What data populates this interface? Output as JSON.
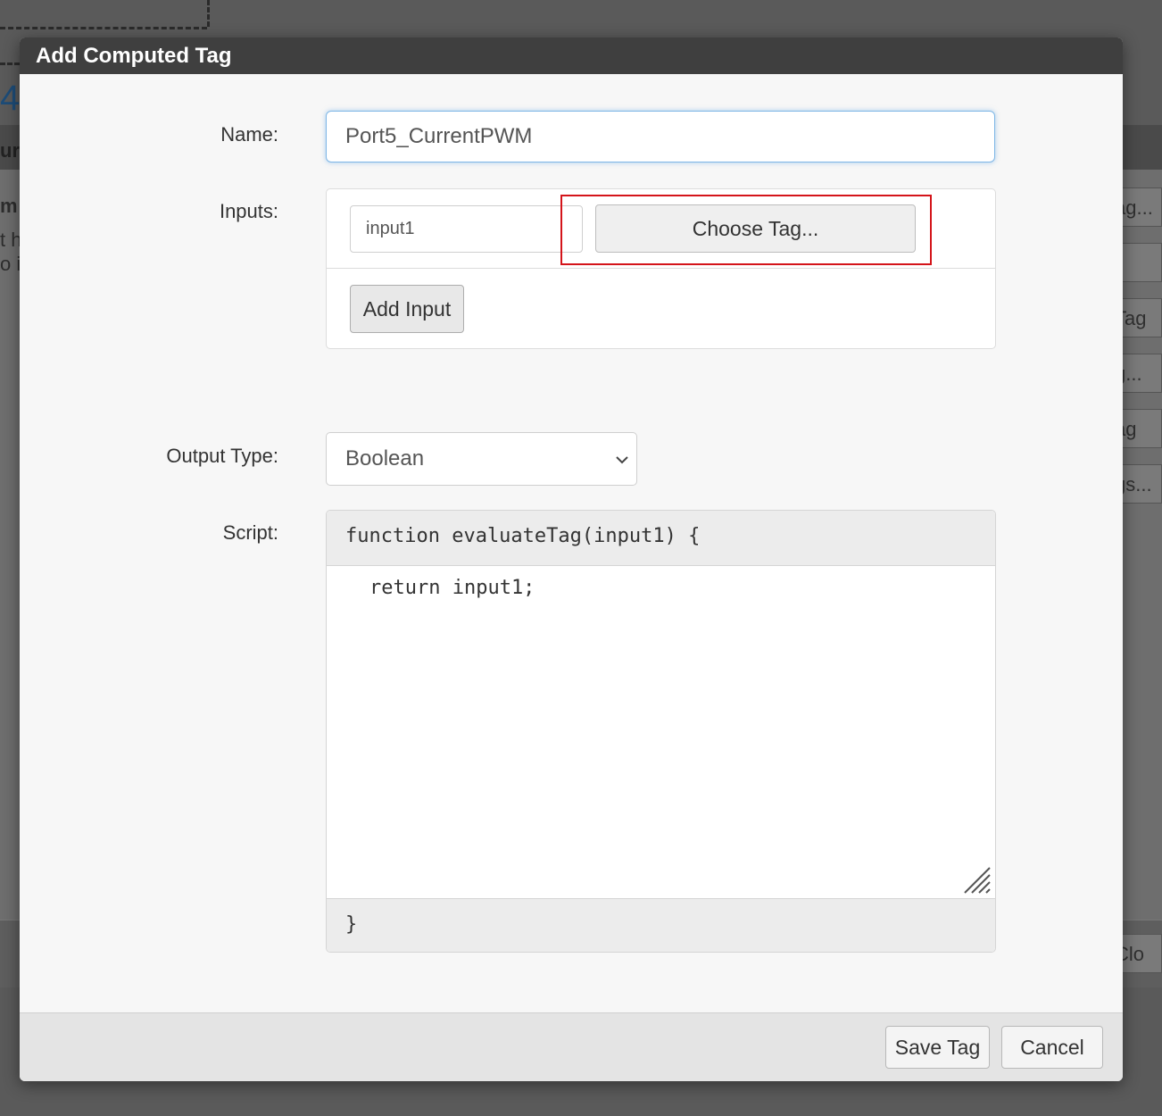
{
  "background": {
    "number_fragment": "4",
    "left_fragments": [
      "ur",
      "m",
      "t h",
      "o i"
    ],
    "right_fragments": [
      "ag...",
      "Tag",
      "g...",
      "ag",
      "gs...",
      "Clo"
    ]
  },
  "dialog": {
    "title": "Add Computed Tag",
    "name": {
      "label": "Name:",
      "value": "Port5_CurrentPWM"
    },
    "inputs": {
      "label": "Inputs:",
      "rows": [
        {
          "value": "input1",
          "choose_label": "Choose Tag..."
        }
      ],
      "add_label": "Add Input"
    },
    "output_type": {
      "label": "Output Type:",
      "selected": "Boolean"
    },
    "script": {
      "label": "Script:",
      "header": "function evaluateTag(input1) {",
      "body": "return input1;",
      "footer": "}"
    },
    "footer": {
      "save_label": "Save Tag",
      "cancel_label": "Cancel"
    }
  },
  "colors": {
    "highlight": "#d4141a",
    "title_bar": "#3f3f3f",
    "focus_border": "#7eb6e6"
  }
}
